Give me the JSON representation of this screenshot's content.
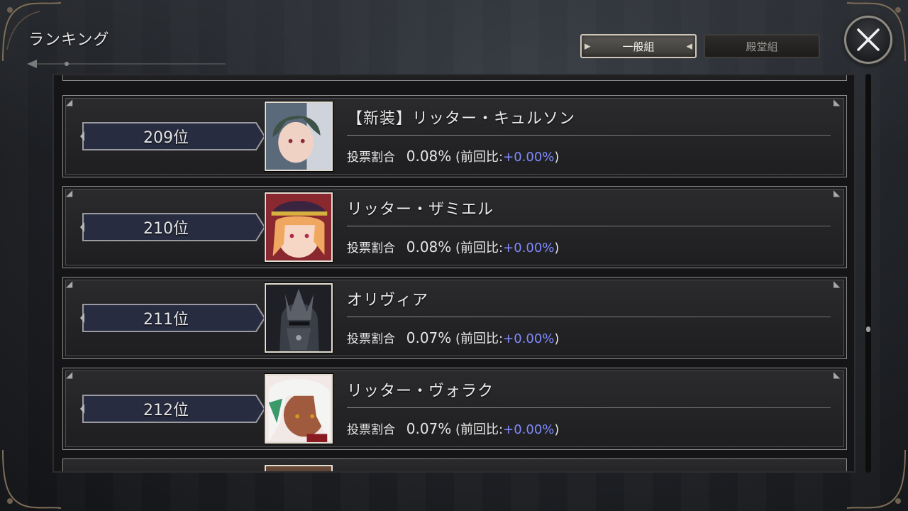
{
  "header": {
    "title": "ランキング"
  },
  "tabs": [
    {
      "label": "一般組",
      "active": true
    },
    {
      "label": "殿堂組",
      "active": false
    }
  ],
  "close_button": {
    "icon": "close-icon"
  },
  "ranking": {
    "vote_label": "投票割合",
    "rows": [
      {
        "rank": "209位",
        "name": "【新装】リッター・キュルソン",
        "share": "0.08%",
        "delta_prefix": "(前回比:",
        "delta": "+0.00%",
        "delta_suffix": ")"
      },
      {
        "rank": "210位",
        "name": "リッター・ザミエル",
        "share": "0.08%",
        "delta_prefix": "(前回比:",
        "delta": "+0.00%",
        "delta_suffix": ")"
      },
      {
        "rank": "211位",
        "name": "オリヴィア",
        "share": "0.07%",
        "delta_prefix": "(前回比:",
        "delta": "+0.00%",
        "delta_suffix": ")"
      },
      {
        "rank": "212位",
        "name": "リッター・ヴォラク",
        "share": "0.07%",
        "delta_prefix": "(前回比:",
        "delta": "+0.00%",
        "delta_suffix": ")"
      }
    ]
  },
  "colors": {
    "delta_positive": "#7f8cff",
    "tab_active_border": "#cfc7b8"
  }
}
